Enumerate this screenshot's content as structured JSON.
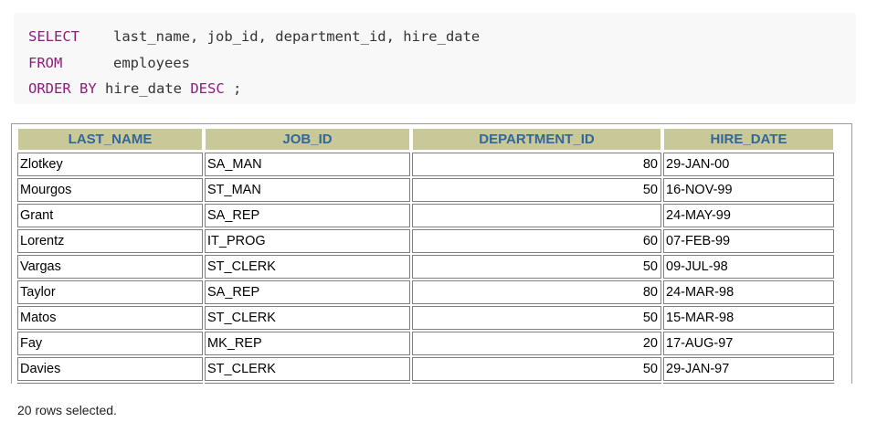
{
  "query": {
    "line1": {
      "keyword": "SELECT",
      "text": "last_name, job_id, department_id, hire_date"
    },
    "line2": {
      "keyword": "FROM",
      "text": "employees"
    },
    "line3": {
      "keyword": "ORDER BY",
      "text": "hire_date",
      "keyword2": "DESC",
      "terminator": ";"
    }
  },
  "table": {
    "columns": [
      "LAST_NAME",
      "JOB_ID",
      "DEPARTMENT_ID",
      "HIRE_DATE"
    ],
    "rows": [
      [
        "Zlotkey",
        "SA_MAN",
        "80",
        "29-JAN-00"
      ],
      [
        "Mourgos",
        "ST_MAN",
        "50",
        "16-NOV-99"
      ],
      [
        "Grant",
        "SA_REP",
        "",
        "24-MAY-99"
      ],
      [
        "Lorentz",
        "IT_PROG",
        "60",
        "07-FEB-99"
      ],
      [
        "Vargas",
        "ST_CLERK",
        "50",
        "09-JUL-98"
      ],
      [
        "Taylor",
        "SA_REP",
        "80",
        "24-MAR-98"
      ],
      [
        "Matos",
        "ST_CLERK",
        "50",
        "15-MAR-98"
      ],
      [
        "Fay",
        "MK_REP",
        "20",
        "17-AUG-97"
      ],
      [
        "Davies",
        "ST_CLERK",
        "50",
        "29-JAN-97"
      ],
      [
        "",
        "",
        "",
        ""
      ]
    ]
  },
  "status_text": "20 rows selected.",
  "colors": {
    "keyword": "#8a1f7a",
    "header_bg": "#c8c899",
    "header_text": "#336699"
  }
}
